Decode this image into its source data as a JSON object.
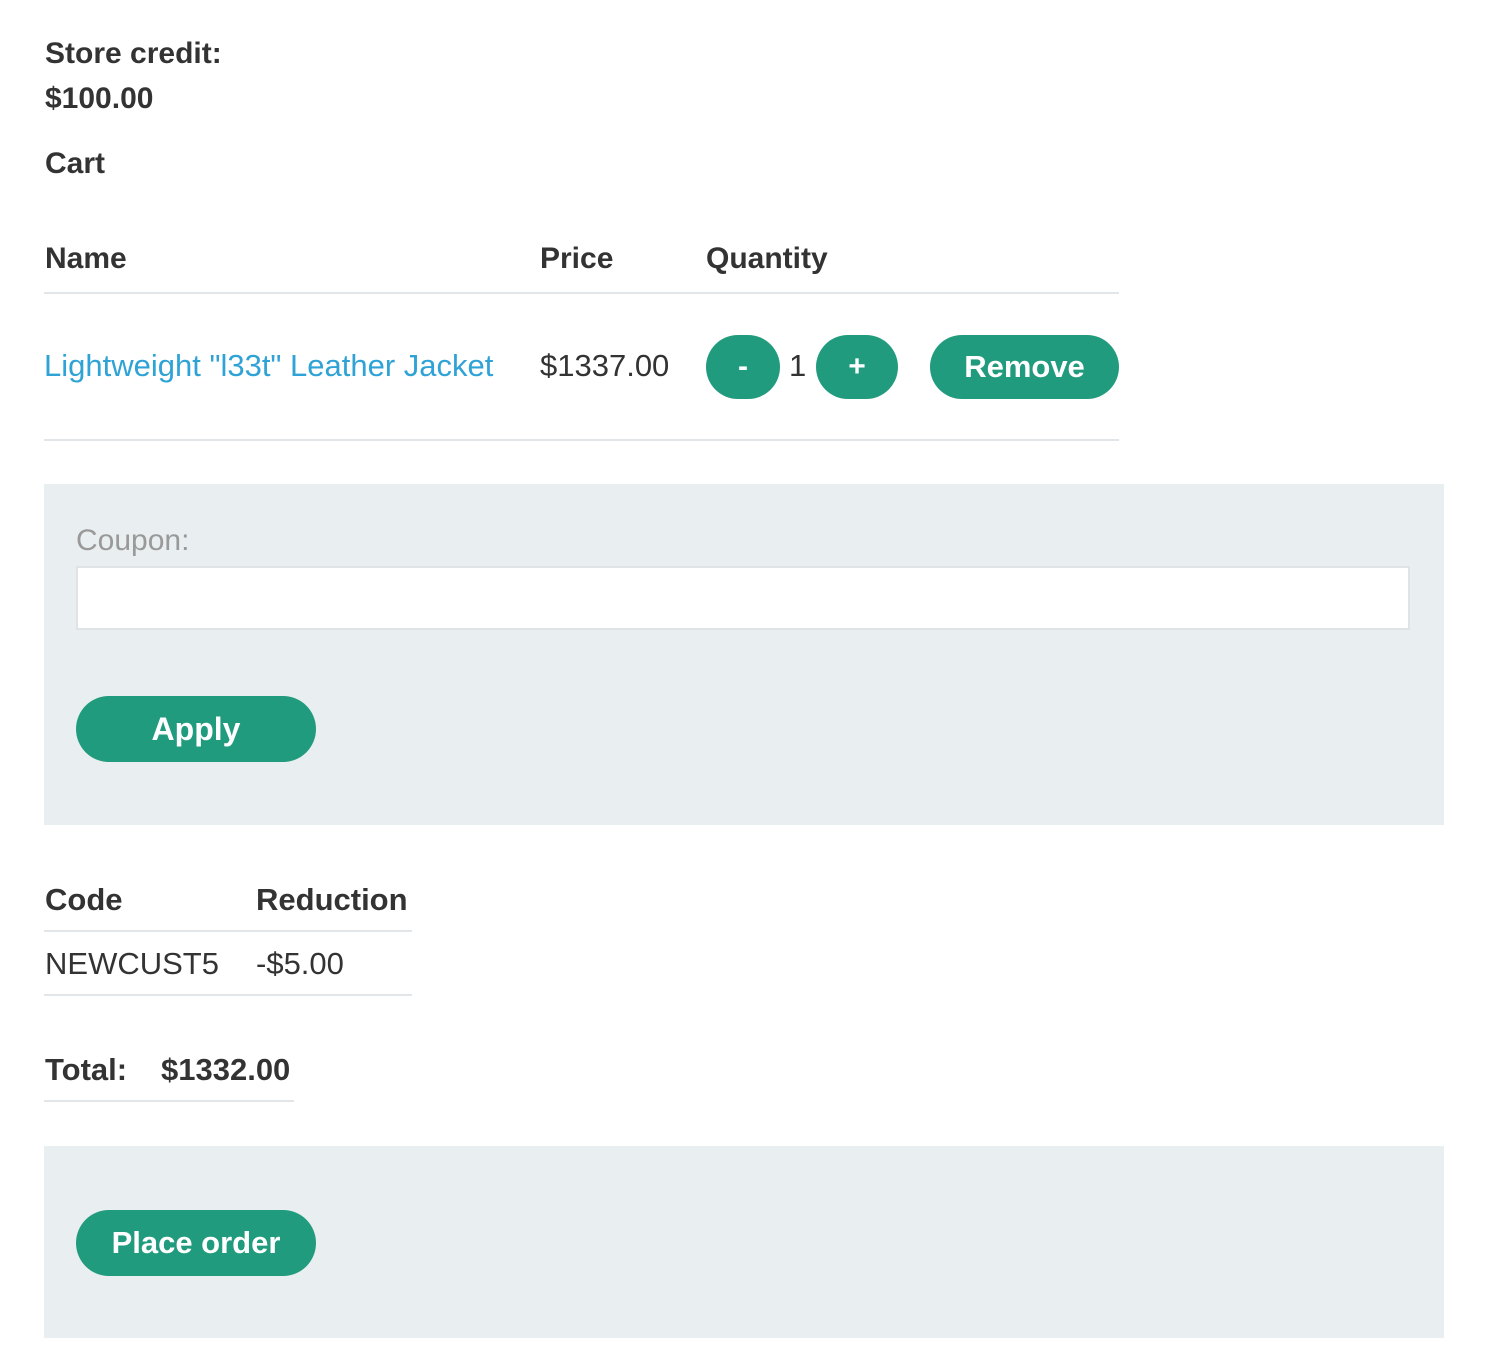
{
  "store_credit": {
    "label": "Store credit:",
    "value": "$100.00"
  },
  "cart": {
    "title": "Cart",
    "columns": {
      "name": "Name",
      "price": "Price",
      "quantity": "Quantity"
    },
    "items": [
      {
        "name": "Lightweight \"l33t\" Leather Jacket",
        "price": "$1337.00",
        "quantity": "1",
        "decrement_label": "-",
        "increment_label": "+",
        "remove_label": "Remove"
      }
    ]
  },
  "coupon": {
    "label": "Coupon:",
    "value": "",
    "apply_label": "Apply"
  },
  "discounts": {
    "columns": {
      "code": "Code",
      "reduction": "Reduction"
    },
    "rows": [
      {
        "code": "NEWCUST5",
        "reduction": "-$5.00"
      }
    ]
  },
  "total": {
    "label": "Total:",
    "value": "$1332.00"
  },
  "order": {
    "place_label": "Place order"
  },
  "colors": {
    "accent": "#219b7d",
    "link": "#2fa3d6",
    "panel_bg": "#e9eef0",
    "text": "#333333"
  }
}
